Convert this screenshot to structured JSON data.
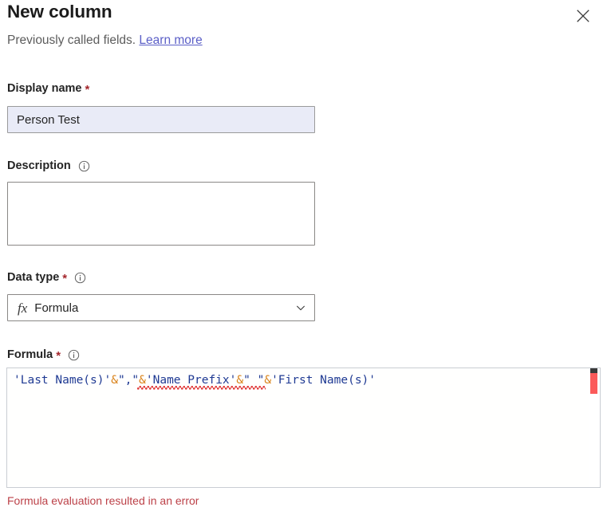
{
  "header": {
    "title": "New column",
    "subtitle_text": "Previously called fields.",
    "link_label": "Learn more",
    "close_icon": "close-icon"
  },
  "fields": {
    "display_name": {
      "label": "Display name",
      "required_marker": "*",
      "value": "Person Test",
      "placeholder": ""
    },
    "description": {
      "label": "Description",
      "info_icon": "info-icon",
      "value": "",
      "placeholder": ""
    },
    "data_type": {
      "label": "Data type",
      "required_marker": "*",
      "info_icon": "info-icon",
      "type_icon": "fx-icon",
      "type_icon_glyph": "fx",
      "selected": "Formula",
      "chevron_icon": "chevron-down-icon"
    },
    "formula": {
      "label": "Formula",
      "required_marker": "*",
      "info_icon": "info-icon",
      "value": "'Last Name(s)'&\",\"&'Name Prefix'&\" \"&'First Name(s)'",
      "tokens": [
        {
          "text": "'Last Name(s)'",
          "kind": "field"
        },
        {
          "text": "&",
          "kind": "amp"
        },
        {
          "text": "\",\"",
          "kind": "str"
        },
        {
          "text": "&",
          "kind": "amp"
        },
        {
          "text": "'Name Prefix'",
          "kind": "field"
        },
        {
          "text": "&",
          "kind": "amp"
        },
        {
          "text": "\" \"",
          "kind": "str"
        },
        {
          "text": "&",
          "kind": "amp"
        },
        {
          "text": "'First Name(s)'",
          "kind": "field"
        }
      ]
    }
  },
  "error": {
    "message": "Formula evaluation resulted in an error"
  },
  "colors": {
    "required_star": "#a4262c",
    "link": "#5b5fc7",
    "error_text": "#bc4148",
    "error_marker": "#fb5a5a",
    "input_focus_fill": "#e9ebf7",
    "formula_field_token": "#1f3a93",
    "formula_operator_token": "#d98218",
    "squiggle": "#e03a3a"
  }
}
